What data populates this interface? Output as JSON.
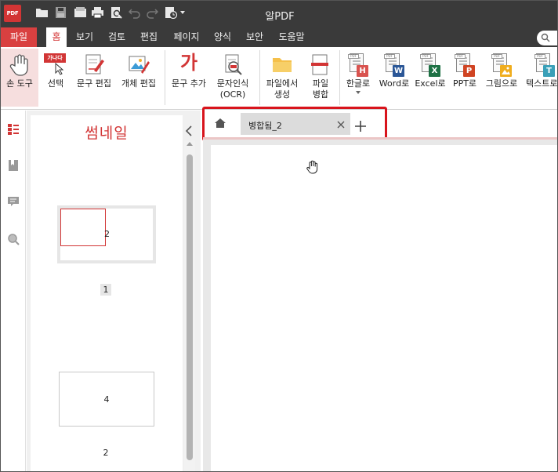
{
  "window": {
    "title": "알PDF",
    "logo_text": "PDF"
  },
  "menu": {
    "tabs": [
      "파일",
      "홈",
      "보기",
      "검토",
      "편집",
      "페이지",
      "양식",
      "보안",
      "도움말"
    ],
    "active": "홈"
  },
  "ribbon": {
    "hand_tool": "손 도구",
    "select": "선택",
    "select_badge": "가나다",
    "text_edit": "문구 편집",
    "object_edit": "개체 편집",
    "add_text": "문구 추가",
    "add_text_icon": "가",
    "ocr_line1": "문자인식",
    "ocr_line2": "(OCR)",
    "create_from_file_line1": "파일에서",
    "create_from_file_line2": "생성",
    "merge_line1": "파일",
    "merge_line2": "병합",
    "to_hangul": "한글로",
    "to_word": "Word로",
    "to_excel": "Excel로",
    "to_ppt": "PPT로",
    "to_image": "그림으로",
    "to_text": "텍스트로",
    "badge_colors": {
      "hangul": "#d9534f",
      "word": "#2b5797",
      "excel": "#1e7145",
      "ppt": "#d04423",
      "image": "#f0ad1e",
      "text": "#3aa0b8"
    },
    "badge_letters": {
      "hangul": "H",
      "word": "W",
      "excel": "X",
      "ppt": "P",
      "image": "",
      "text": "T"
    }
  },
  "thumbnails": {
    "title": "썸네일",
    "pages": [
      {
        "content": "2",
        "page_number": "1"
      },
      {
        "content": "4",
        "page_number": "2"
      }
    ]
  },
  "document_tabs": {
    "active_label": "병합됨_2"
  },
  "colors": {
    "accent": "#d23535",
    "highlight": "#d8141c",
    "titlebar": "#3a3a3a"
  }
}
